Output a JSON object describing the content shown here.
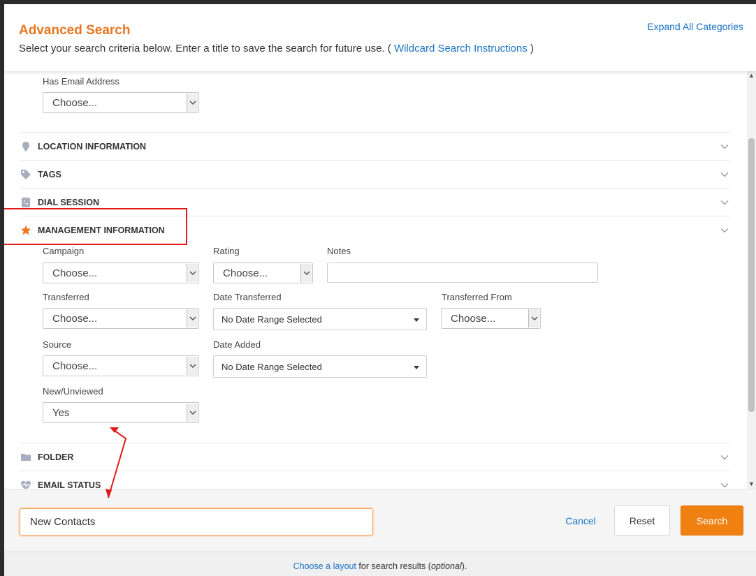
{
  "header": {
    "title": "Advanced Search",
    "subtitle_prefix": "Select your search criteria below. Enter a title to save the search for future use. (",
    "subtitle_link": "Wildcard Search Instructions",
    "subtitle_suffix": ")",
    "expand_link": "Expand All Categories"
  },
  "email_field": {
    "label": "Has Email Address",
    "value": "Choose..."
  },
  "sections": {
    "location": "LOCATION INFORMATION",
    "tags": "TAGS",
    "dial_session": "DIAL SESSION",
    "management": "MANAGEMENT INFORMATION",
    "folder": "FOLDER",
    "email_status": "EMAIL STATUS"
  },
  "management": {
    "campaign": {
      "label": "Campaign",
      "value": "Choose..."
    },
    "rating": {
      "label": "Rating",
      "value": "Choose..."
    },
    "notes": {
      "label": "Notes",
      "value": ""
    },
    "transferred": {
      "label": "Transferred",
      "value": "Choose..."
    },
    "date_transferred": {
      "label": "Date Transferred",
      "value": "No Date Range Selected"
    },
    "transferred_from": {
      "label": "Transferred From",
      "value": "Choose..."
    },
    "source": {
      "label": "Source",
      "value": "Choose..."
    },
    "date_added": {
      "label": "Date Added",
      "value": "No Date Range Selected"
    },
    "new_unviewed": {
      "label": "New/Unviewed",
      "value": "Yes"
    }
  },
  "footer": {
    "search_title_value": "New Contacts",
    "cancel_label": "Cancel",
    "reset_label": "Reset",
    "search_label": "Search"
  },
  "layout_bar": {
    "link": "Choose a layout",
    "text": " for search results (",
    "optional": "optional",
    "end": ")."
  },
  "colors": {
    "accent": "#f08012",
    "title": "#e87722",
    "link": "#1a73c4",
    "highlight": "#e01b1b"
  }
}
